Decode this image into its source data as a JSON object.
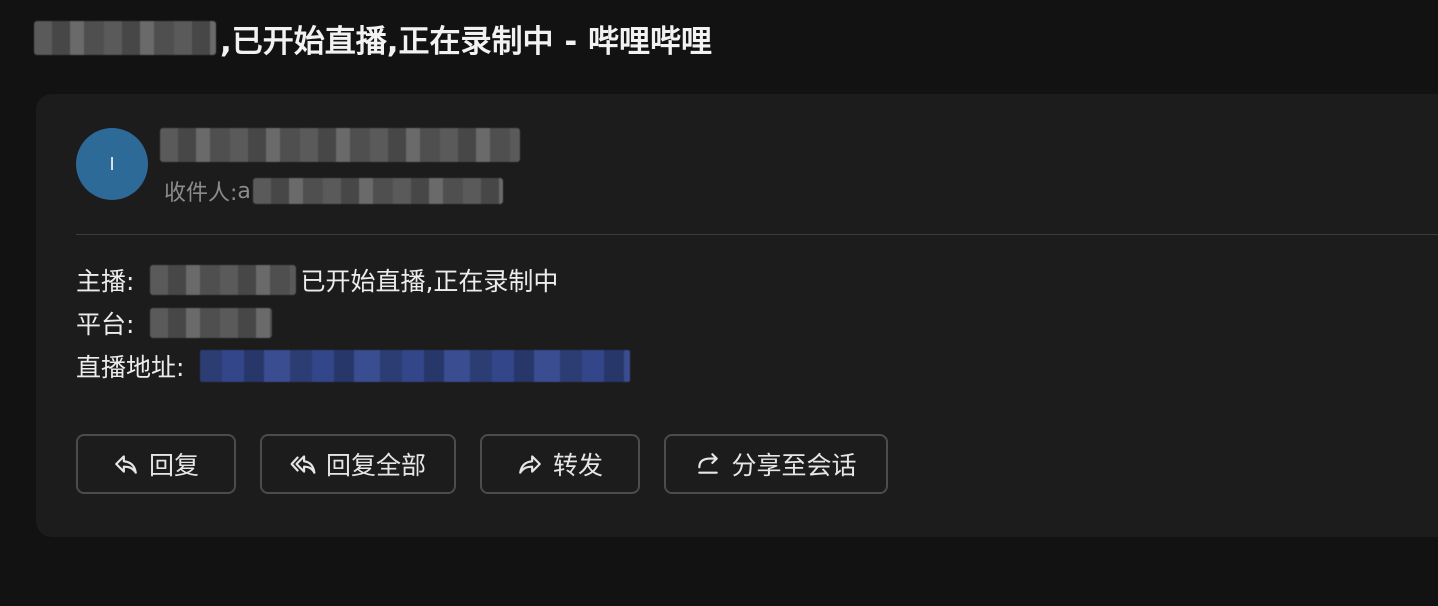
{
  "email": {
    "subject_suffix": ",已开始直播,正在录制中 - 哔哩哔哩",
    "avatar_initial": "I",
    "recipient_label": "收件人:",
    "recipient_prefix": "a",
    "body": {
      "streamer_label": "主播:",
      "streamer_suffix": "已开始直播,正在录制中",
      "platform_label": "平台:",
      "url_label": "直播地址:"
    }
  },
  "actions": {
    "reply": "回复",
    "reply_all": "回复全部",
    "forward": "转发",
    "share": "分享至会话"
  },
  "colors": {
    "background": "#121212",
    "card": "#1c1c1c",
    "avatar": "#2e6a97",
    "link": "#34468a"
  }
}
